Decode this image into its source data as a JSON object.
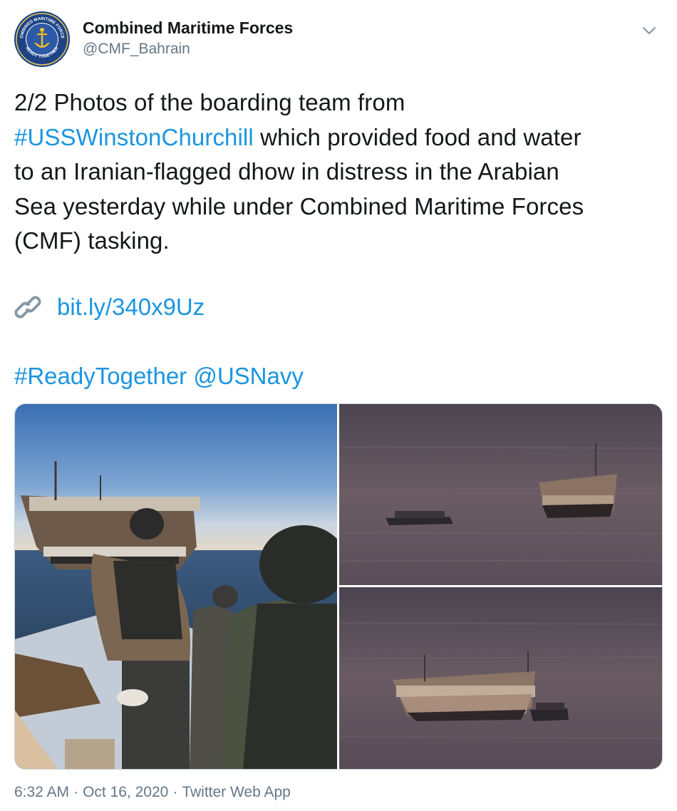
{
  "account": {
    "name": "Combined Maritime Forces",
    "handle": "@CMF_Bahrain",
    "avatar_texts": [
      "COMBINED MARITIME FORCES",
      "READY TOGETHER"
    ]
  },
  "tweet": {
    "lines": [
      [
        {
          "text": "2/2 Photos of the boarding team from"
        }
      ],
      [
        {
          "text": "#USSWinstonChurchill",
          "link": true
        },
        {
          "text": " which provided food and water"
        }
      ],
      [
        {
          "text": "to an Iranian-flagged dhow in distress in the Arabian"
        }
      ],
      [
        {
          "text": "Sea yesterday while under Combined Maritime Forces"
        }
      ],
      [
        {
          "text": "(CMF) tasking."
        }
      ]
    ],
    "link_icon": "link-chain-icon",
    "link_url": "bit.ly/340x9Uz",
    "hashtag": "#ReadyTogether",
    "mention": "@USNavy"
  },
  "media": {
    "photos": [
      {
        "name": "photo-boarding-team"
      },
      {
        "name": "photo-dhow-and-boat-distance"
      },
      {
        "name": "photo-dhow-and-boat-close"
      }
    ]
  },
  "meta": {
    "time": "6:32 AM",
    "separator": "·",
    "date": "Oct 16, 2020",
    "source": "Twitter Web App"
  },
  "colors": {
    "link": "#1b95e0",
    "text": "#14171a",
    "secondary": "#657786"
  },
  "icons": {
    "caret": "chevron-down-icon",
    "link": "link-chain-icon"
  }
}
